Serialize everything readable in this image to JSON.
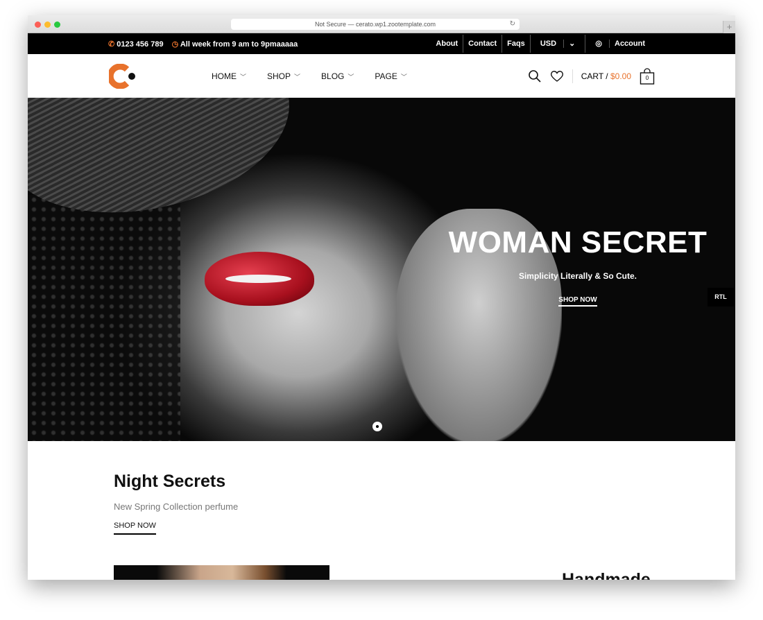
{
  "browser": {
    "url": "Not Secure — cerato.wp1.zootemplate.com"
  },
  "topbar": {
    "phone": "0123 456 789",
    "hours": "All week from 9 am to 9pmaaaaa",
    "links": [
      "About",
      "Contact",
      "Faqs"
    ],
    "currency": "USD",
    "account": "Account"
  },
  "nav": {
    "items": [
      "HOME",
      "SHOP",
      "BLOG",
      "PAGE"
    ]
  },
  "cart": {
    "label": "CART /",
    "amount": "$0.00",
    "count": "0"
  },
  "hero": {
    "title": "WOMAN SECRET",
    "subtitle": "Simplicity Literally & So Cute.",
    "button": "SHOP NOW",
    "rtl": "RTL"
  },
  "section": {
    "title": "Night Secrets",
    "subtitle": "New Spring Collection perfume",
    "button": "SHOP NOW",
    "next_title": "Handmade"
  },
  "colors": {
    "accent": "#e8722c"
  }
}
